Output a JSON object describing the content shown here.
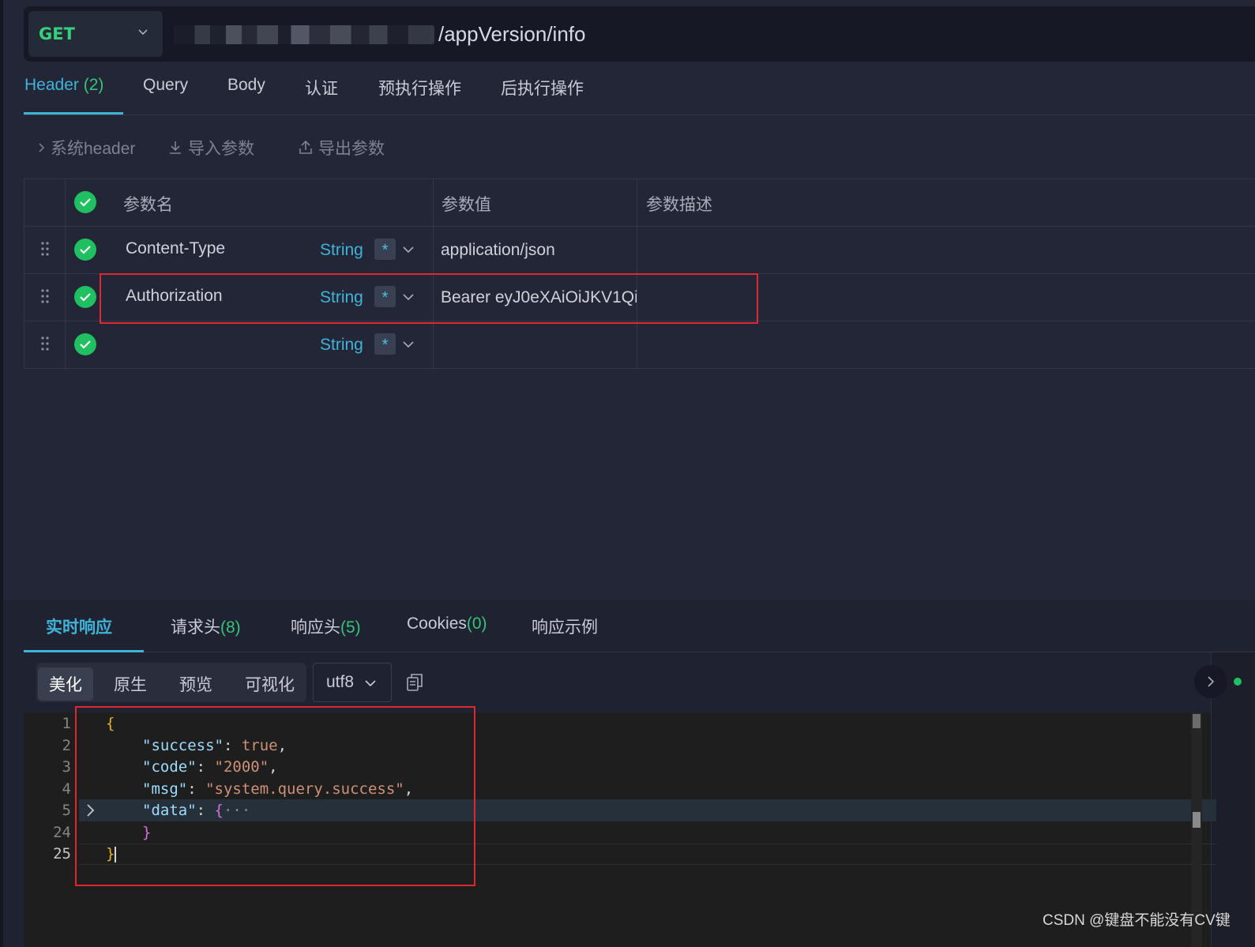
{
  "request": {
    "method": "GET",
    "url_suffix": "/appVersion/info"
  },
  "tabs": [
    {
      "label": "Header",
      "count": "(2)"
    },
    {
      "label": "Query"
    },
    {
      "label": "Body"
    },
    {
      "label": "认证"
    },
    {
      "label": "预执行操作"
    },
    {
      "label": "后执行操作"
    }
  ],
  "toolbar": {
    "system_header": "系统header",
    "import": "导入参数",
    "export": "导出参数"
  },
  "params_table": {
    "headers": [
      "参数名",
      "参数值",
      "参数描述"
    ],
    "rows": [
      {
        "name": "Content-Type",
        "type": "String",
        "required": "*",
        "value": "application/json"
      },
      {
        "name": "Authorization",
        "type": "String",
        "required": "*",
        "value": "Bearer eyJ0eXAiOiJKV1Qi"
      },
      {
        "name": "",
        "type": "String",
        "required": "*",
        "value": ""
      }
    ]
  },
  "response_tabs": [
    {
      "label": "实时响应"
    },
    {
      "label": "请求头",
      "count": "(8)"
    },
    {
      "label": "响应头",
      "count": "(5)"
    },
    {
      "label": "Cookies",
      "count": "(0)"
    },
    {
      "label": "响应示例"
    }
  ],
  "view_modes": [
    "美化",
    "原生",
    "预览",
    "可视化"
  ],
  "encoding": "utf8",
  "editor": {
    "line_numbers": [
      "1",
      "2",
      "3",
      "4",
      "5",
      "24",
      "25"
    ],
    "lines": {
      "open": "{",
      "success_key": "\"success\"",
      "success_val": "true",
      "code_key": "\"code\"",
      "code_val": "\"2000\"",
      "msg_key": "\"msg\"",
      "msg_val": "\"system.query.success\"",
      "data_key": "\"data\"",
      "data_open": "{",
      "ellipsis": "···",
      "inner_close": "}",
      "close": "}"
    }
  },
  "watermark": "CSDN @键盘不能没有CV键",
  "colors": {
    "accent": "#3fb3d8",
    "method_green": "#36d07a",
    "check_green": "#1fbf62",
    "highlight_red": "#e0262e"
  }
}
